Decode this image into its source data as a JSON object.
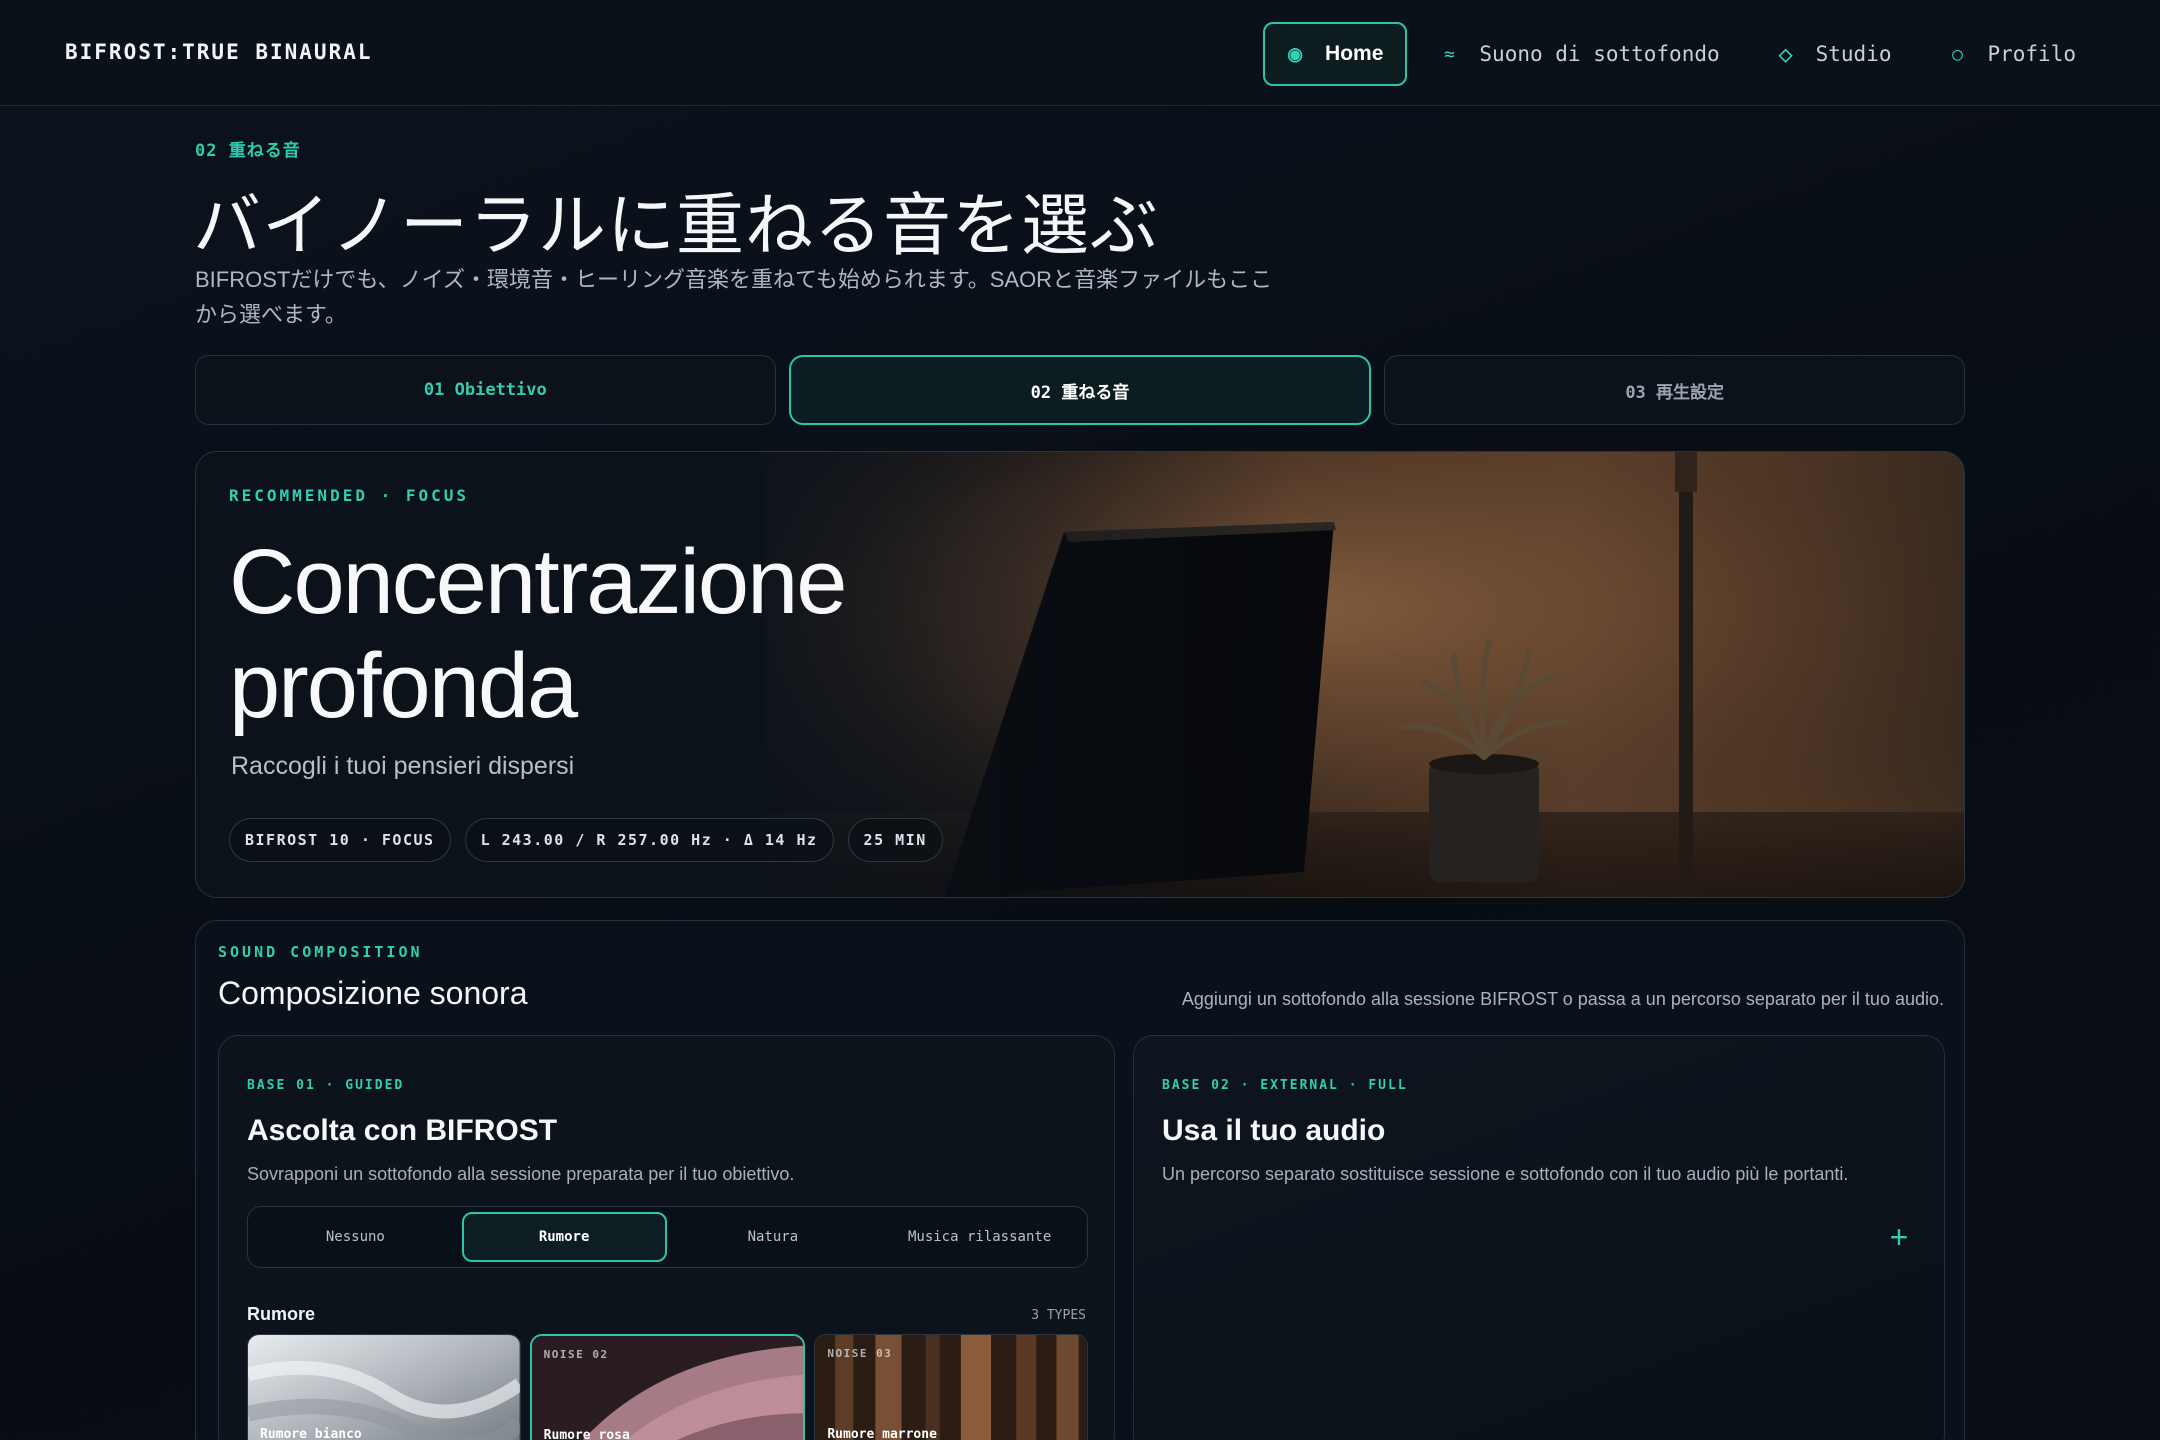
{
  "brand": "BIFROST:TRUE BINAURAL",
  "nav": {
    "home": {
      "icon": "◉",
      "label": "Home"
    },
    "sound": {
      "icon": "≈",
      "label": "Suono di sottofondo"
    },
    "studio": {
      "icon": "◇",
      "label": "Studio"
    },
    "profile": {
      "icon": "○",
      "label": "Profilo"
    }
  },
  "header": {
    "kicker": "02 重ねる音",
    "title": "バイノーラルに重ねる音を選ぶ",
    "description": "BIFROSTだけでも、ノイズ・環境音・ヒーリング音楽を重ねても始められます。SAORと音楽ファイルもここから選べます。"
  },
  "steps": [
    {
      "label": "01 Obiettivo"
    },
    {
      "label": "02 重ねる音"
    },
    {
      "label": "03 再生設定"
    }
  ],
  "hero": {
    "kicker": "RECOMMENDED · FOCUS",
    "title_line1": "Concentrazione",
    "title_line2": "profonda",
    "subtitle": "Raccogli i tuoi pensieri dispersi",
    "chips": [
      "BIFROST 10 · FOCUS",
      "L 243.00 / R 257.00 Hz · Δ 14 Hz",
      "25 MIN"
    ]
  },
  "composition": {
    "kicker": "SOUND COMPOSITION",
    "title": "Composizione sonora",
    "note": "Aggiungi un sottofondo alla sessione BIFROST o passa a un percorso separato per il tuo audio.",
    "left_card": {
      "kicker": "BASE 01 · GUIDED",
      "title": "Ascolta con BIFROST",
      "description": "Sovrapponi un sottofondo alla sessione preparata per il tuo obiettivo.",
      "options": [
        "Nessuno",
        "Rumore",
        "Natura",
        "Musica rilassante"
      ],
      "selected_option": "Rumore",
      "noise_heading": "Rumore",
      "noise_count": "3 TYPES",
      "tiles": [
        {
          "tag": "",
          "name": "Rumore bianco"
        },
        {
          "tag": "NOISE 02",
          "name": "Rumore rosa"
        },
        {
          "tag": "NOISE 03",
          "name": "Rumore marrone"
        }
      ]
    },
    "right_card": {
      "kicker": "BASE 02 · EXTERNAL · FULL",
      "title": "Usa il tuo audio",
      "description": "Un percorso separato sostituisce sessione e sottofondo con il tuo audio più le portanti.",
      "add_icon": "+"
    }
  },
  "colors": {
    "accent": "#2ec4a9",
    "background": "#0a1018"
  }
}
